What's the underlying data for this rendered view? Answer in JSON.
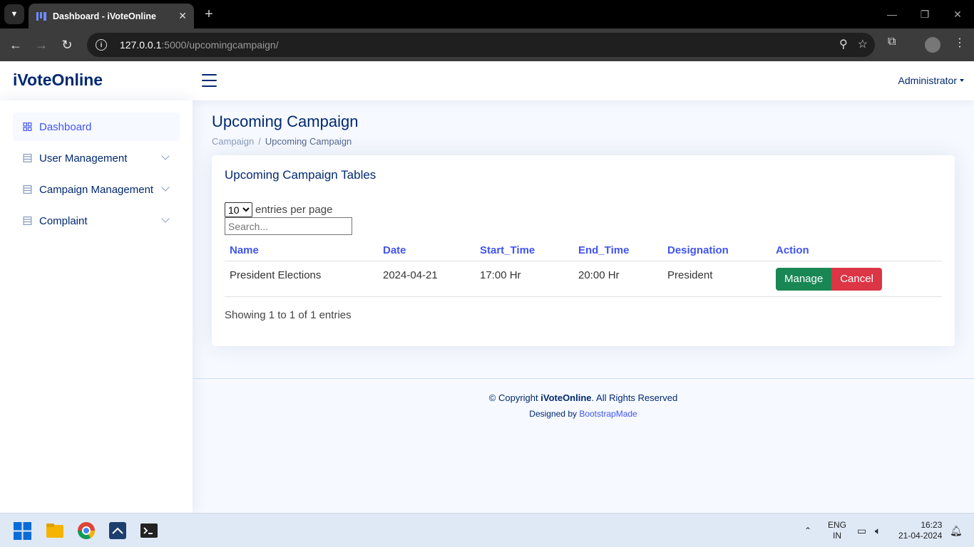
{
  "browser": {
    "tab_title": "Dashboard - iVoteOnline",
    "url_host": "127.0.0.1",
    "url_rest": ":5000/upcomingcampaign/"
  },
  "header": {
    "logo": "iVoteOnline",
    "user": "Administrator"
  },
  "sidebar": {
    "items": [
      {
        "label": "Dashboard",
        "active": true
      },
      {
        "label": "User Management"
      },
      {
        "label": "Campaign Management"
      },
      {
        "label": "Complaint"
      }
    ]
  },
  "page": {
    "title": "Upcoming Campaign",
    "breadcrumb": [
      "Campaign",
      "Upcoming Campaign"
    ]
  },
  "card": {
    "title": "Upcoming Campaign Tables",
    "per_page_value": "10",
    "per_page_label": "entries per page",
    "search_placeholder": "Search...",
    "columns": [
      "Name",
      "Date",
      "Start_Time",
      "End_Time",
      "Designation",
      "Action"
    ],
    "rows": [
      {
        "name": "President Elections",
        "date": "2024-04-21",
        "start": "17:00 Hr",
        "end": "20:00 Hr",
        "designation": "President",
        "manage": "Manage",
        "cancel": "Cancel"
      }
    ],
    "showing": "Showing 1 to 1 of 1 entries"
  },
  "footer": {
    "copyright_prefix": "© Copyright ",
    "brand": "iVoteOnline",
    "copyright_suffix": ". All Rights Reserved",
    "designed_by": "Designed by ",
    "designer": "BootstrapMade"
  },
  "taskbar": {
    "lang": "ENG",
    "region": "IN",
    "time": "16:23",
    "date": "21-04-2024"
  },
  "colors": {
    "primary": "#4154f1",
    "navy": "#012970",
    "manage": "#198754",
    "cancel": "#dc3545"
  }
}
